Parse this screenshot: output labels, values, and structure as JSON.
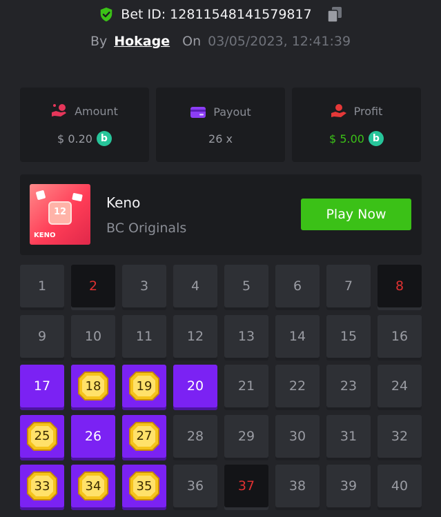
{
  "header": {
    "bet_label": "Bet ID: 12811548141579817",
    "by_label": "By",
    "username": "Hokage",
    "on_label": "On",
    "datetime": "03/05/2023, 12:41:39"
  },
  "stats": {
    "amount": {
      "label": "Amount",
      "value": "$ 0.20",
      "icon": "money-hand-icon"
    },
    "payout": {
      "label": "Payout",
      "value": "26 x",
      "icon": "card-icon"
    },
    "profit": {
      "label": "Profit",
      "value": "$ 5.00",
      "icon": "hand-coin-icon"
    }
  },
  "game": {
    "name": "Keno",
    "provider": "BC Originals",
    "thumb_label": "KENO",
    "thumb_number": "12",
    "play_label": "Play Now"
  },
  "tiles": [
    {
      "n": "1",
      "state": "normal"
    },
    {
      "n": "2",
      "state": "miss"
    },
    {
      "n": "3",
      "state": "normal"
    },
    {
      "n": "4",
      "state": "normal"
    },
    {
      "n": "5",
      "state": "normal"
    },
    {
      "n": "6",
      "state": "normal"
    },
    {
      "n": "7",
      "state": "normal"
    },
    {
      "n": "8",
      "state": "miss"
    },
    {
      "n": "9",
      "state": "normal"
    },
    {
      "n": "10",
      "state": "normal"
    },
    {
      "n": "11",
      "state": "normal"
    },
    {
      "n": "12",
      "state": "normal"
    },
    {
      "n": "13",
      "state": "normal"
    },
    {
      "n": "14",
      "state": "normal"
    },
    {
      "n": "15",
      "state": "normal"
    },
    {
      "n": "16",
      "state": "normal"
    },
    {
      "n": "17",
      "state": "picked"
    },
    {
      "n": "18",
      "state": "hit"
    },
    {
      "n": "19",
      "state": "hit"
    },
    {
      "n": "20",
      "state": "picked"
    },
    {
      "n": "21",
      "state": "normal"
    },
    {
      "n": "22",
      "state": "normal"
    },
    {
      "n": "23",
      "state": "normal"
    },
    {
      "n": "24",
      "state": "normal"
    },
    {
      "n": "25",
      "state": "hit"
    },
    {
      "n": "26",
      "state": "picked"
    },
    {
      "n": "27",
      "state": "hit"
    },
    {
      "n": "28",
      "state": "normal"
    },
    {
      "n": "29",
      "state": "normal"
    },
    {
      "n": "30",
      "state": "normal"
    },
    {
      "n": "31",
      "state": "normal"
    },
    {
      "n": "32",
      "state": "normal"
    },
    {
      "n": "33",
      "state": "hit"
    },
    {
      "n": "34",
      "state": "hit"
    },
    {
      "n": "35",
      "state": "hit"
    },
    {
      "n": "36",
      "state": "normal"
    },
    {
      "n": "37",
      "state": "miss"
    },
    {
      "n": "38",
      "state": "normal"
    },
    {
      "n": "39",
      "state": "normal"
    },
    {
      "n": "40",
      "state": "normal"
    }
  ],
  "colors": {
    "background": "#232428",
    "panel": "#1b1c1f",
    "accent_green": "#3bc117",
    "purple": "#7b22f3",
    "miss_red": "#e03131",
    "gold": "#f5c31c"
  }
}
